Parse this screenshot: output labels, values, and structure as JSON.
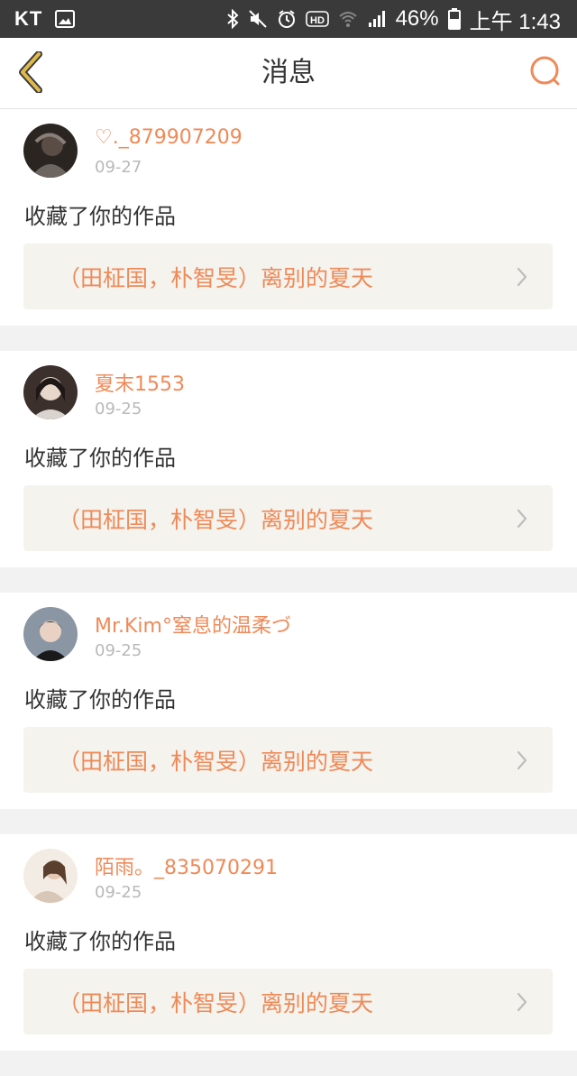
{
  "status_bar": {
    "carrier": "KT",
    "battery_percent": "46%",
    "time": "上午 1:43",
    "icons": [
      "image-icon",
      "bluetooth-icon",
      "mute-icon",
      "alarm-icon",
      "hd-icon",
      "wifi-icon",
      "signal-icon",
      "battery-icon"
    ]
  },
  "header": {
    "title": "消息",
    "back_icon": "chevron-left-icon",
    "search_icon": "search-icon",
    "accent_color": "#ef8a58",
    "back_color": "#e0b94a"
  },
  "messages": [
    {
      "username": "♡._879907209",
      "date": "09-27",
      "action": "收藏了你的作品",
      "work_title": "（田柾国，朴智旻）离别的夏天"
    },
    {
      "username": "夏末1553",
      "date": "09-25",
      "action": "收藏了你的作品",
      "work_title": "（田柾国，朴智旻）离别的夏天"
    },
    {
      "username": "Mr.Kim°窒息的温柔づ",
      "date": "09-25",
      "action": "收藏了你的作品",
      "work_title": "（田柾国，朴智旻）离别的夏天"
    },
    {
      "username": "陌雨。_835070291",
      "date": "09-25",
      "action": "收藏了你的作品",
      "work_title": "（田柾国，朴智旻）离别的夏天"
    }
  ]
}
